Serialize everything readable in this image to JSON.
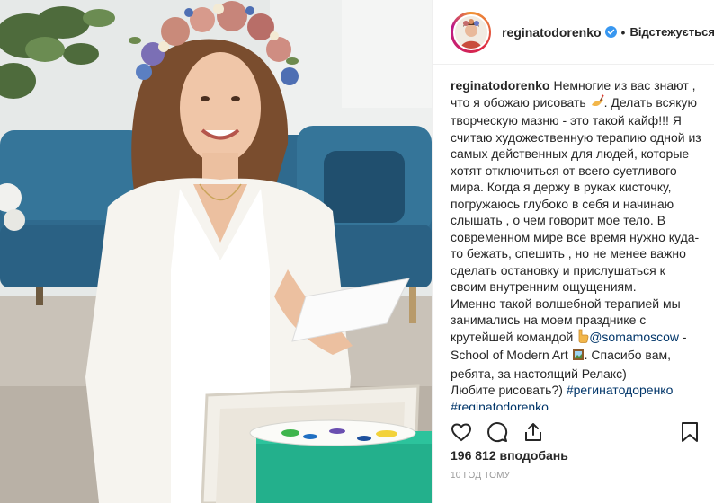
{
  "post": {
    "photo_alt": "Woman in a flower crown and white robe holding paper next to a painting easel"
  },
  "header": {
    "username": "reginatodorenko",
    "separator": "•",
    "follow_label": "Відстежується"
  },
  "caption": {
    "author": "reginatodorenko",
    "part1": "Немногие из вас знают , что я обожаю рисовать ",
    "part2": ". Делать всякую творческую мазню - это такой кайф!!! Я считаю художественную терапию одной из самых действенных для людей, которые хотят отключиться от всего суетливого мира. Когда я держу в руках кисточку, погружаюсь глубоко в себя и начинаю слышать , о чем говорит мое тело. В современном мире все время нужно куда-то бежать, спешить , но не менее важно сделать остановку и прислушаться к своим внутренним ощущениям.",
    "part3": "Именно такой волшебной терапией мы занимались на моем празднике с крутейшей командой ",
    "mention": "@somamoscow",
    "part4": " - School of Modern Art ",
    "part5": ". Спасибо вам, ребята, за настоящий Релакс)",
    "part6": "Любите рисовать?) ",
    "hashtag1": "#регинатодоренко",
    "hashtag2": "#reginatodorenko"
  },
  "actions": {
    "like_icon": "heart-icon",
    "comment_icon": "comment-icon",
    "share_icon": "share-icon",
    "save_icon": "bookmark-icon"
  },
  "stats": {
    "likes_text": "196 812 вподобань",
    "timestamp": "10 год тому"
  },
  "colors": {
    "link": "#003569",
    "text": "#262626",
    "muted": "#999999",
    "verified": "#3897f0"
  }
}
